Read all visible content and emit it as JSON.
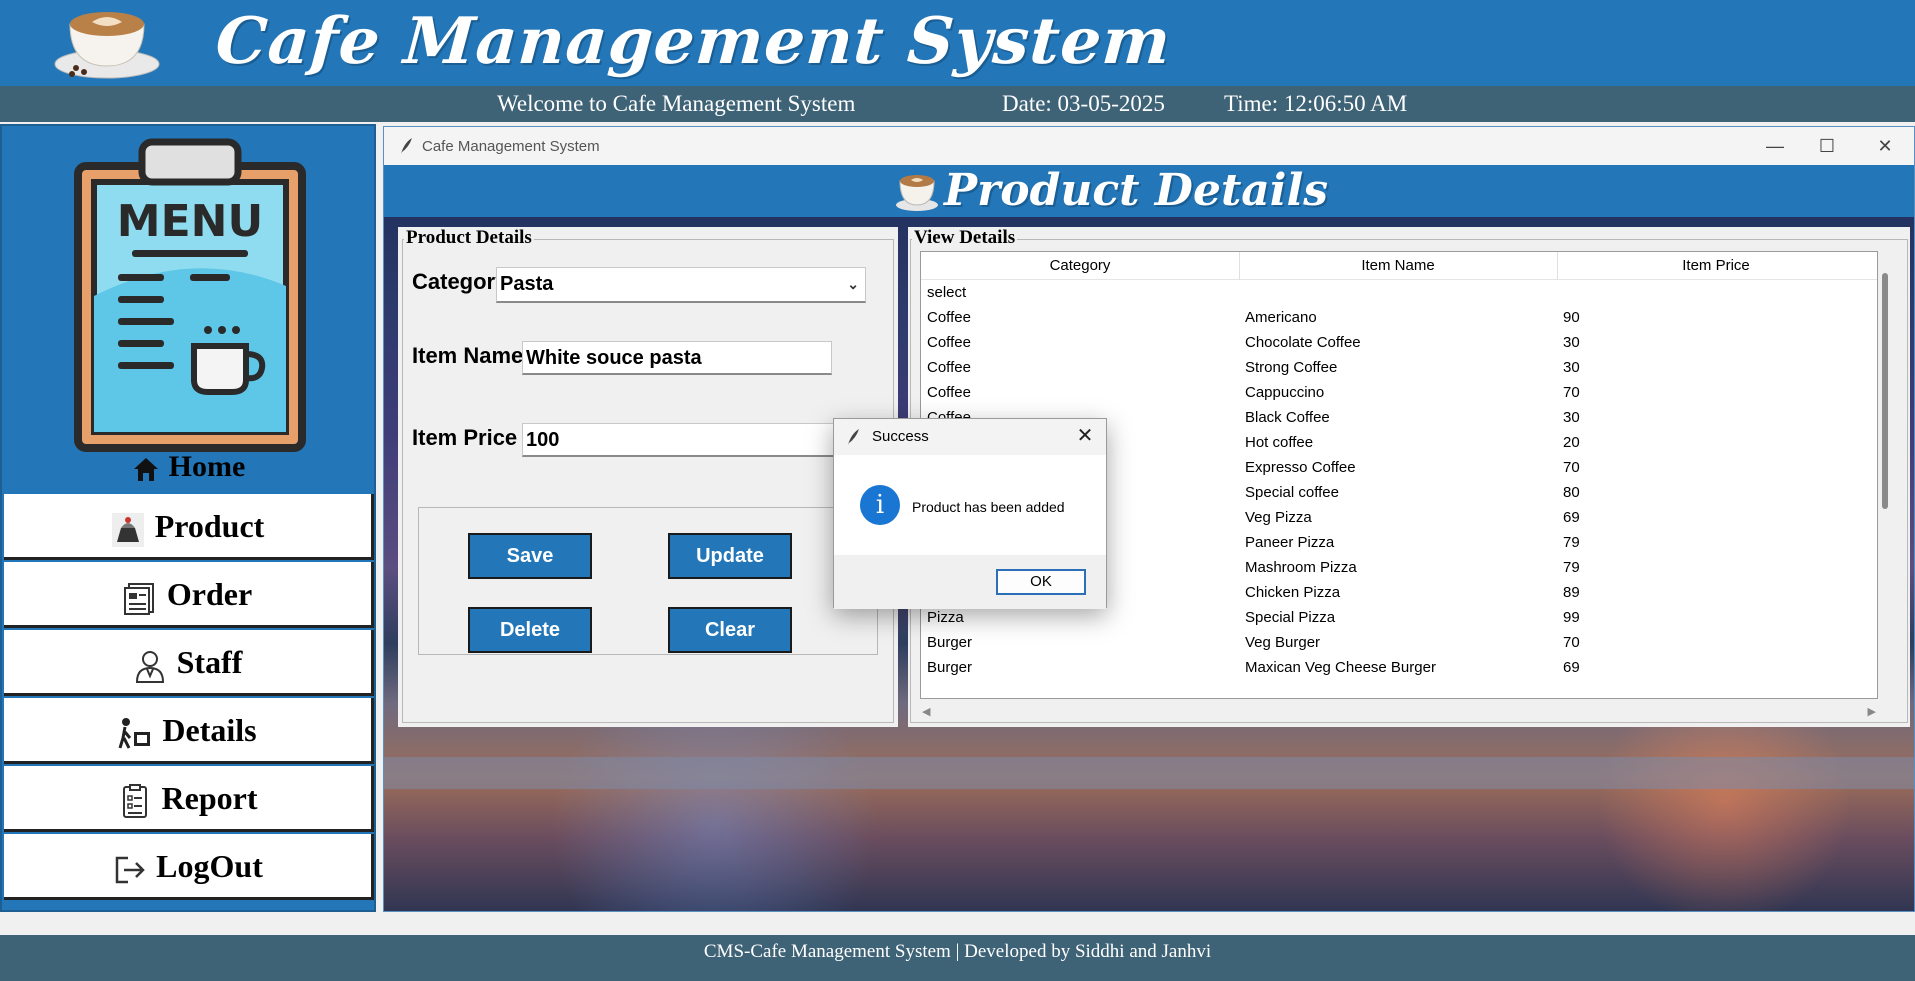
{
  "header": {
    "title": "Cafe Management System"
  },
  "infobar": {
    "welcome": "Welcome to Cafe Management System",
    "date": "Date: 03-05-2025",
    "time": "Time: 12:06:50 AM"
  },
  "sidebar": {
    "home_label": "Home",
    "items": [
      {
        "label": "Product",
        "icon": "product-icon"
      },
      {
        "label": "Order",
        "icon": "order-icon"
      },
      {
        "label": "Staff",
        "icon": "staff-icon"
      },
      {
        "label": "Details",
        "icon": "details-icon"
      },
      {
        "label": "Report",
        "icon": "report-icon"
      },
      {
        "label": "LogOut",
        "icon": "logout-icon"
      }
    ]
  },
  "child_window": {
    "title": "Cafe Management System",
    "banner_title": "Product Details",
    "controls": {
      "minimize": "—",
      "maximize": "☐",
      "close": "✕"
    }
  },
  "product_form": {
    "group_label": "Product Details",
    "category_label": "Category:",
    "category_value": "Pasta",
    "item_name_label": "Item Name :",
    "item_name_value": "White souce pasta",
    "item_price_label": "Item Price :",
    "item_price_value": "100",
    "buttons": {
      "save": "Save",
      "update": "Update",
      "delete": "Delete",
      "clear": "Clear"
    }
  },
  "view_details": {
    "group_label": "View Details",
    "columns": [
      "Category",
      "Item Name",
      "Item Price"
    ],
    "rows": [
      [
        "select",
        "",
        ""
      ],
      [
        "Coffee",
        "Americano",
        "90"
      ],
      [
        "Coffee",
        "Chocolate Coffee",
        "30"
      ],
      [
        "Coffee",
        "Strong Coffee",
        "30"
      ],
      [
        "Coffee",
        "Cappuccino",
        "70"
      ],
      [
        "Coffee",
        "Black Coffee",
        "30"
      ],
      [
        "",
        "Hot coffee",
        "20"
      ],
      [
        "",
        "Expresso Coffee",
        "70"
      ],
      [
        "",
        "Special coffee",
        "80"
      ],
      [
        "",
        "Veg Pizza",
        "69"
      ],
      [
        "",
        "Paneer Pizza",
        "79"
      ],
      [
        "",
        "Mashroom Pizza",
        "79"
      ],
      [
        "",
        "Chicken Pizza",
        "89"
      ],
      [
        "Pizza",
        "Special Pizza",
        "99"
      ],
      [
        "Burger",
        "Veg Burger",
        "70"
      ],
      [
        "Burger",
        "Maxican Veg Cheese Burger",
        "69"
      ]
    ]
  },
  "dialog": {
    "title": "Success",
    "message": "Product has been added",
    "ok": "OK",
    "close": "✕",
    "info_glyph": "i"
  },
  "footer": {
    "text": "CMS-Cafe Management System | Developed by Siddhi and Janhvi"
  },
  "colors": {
    "primary_blue": "#2376b7",
    "slate_bar": "#3e6276"
  }
}
